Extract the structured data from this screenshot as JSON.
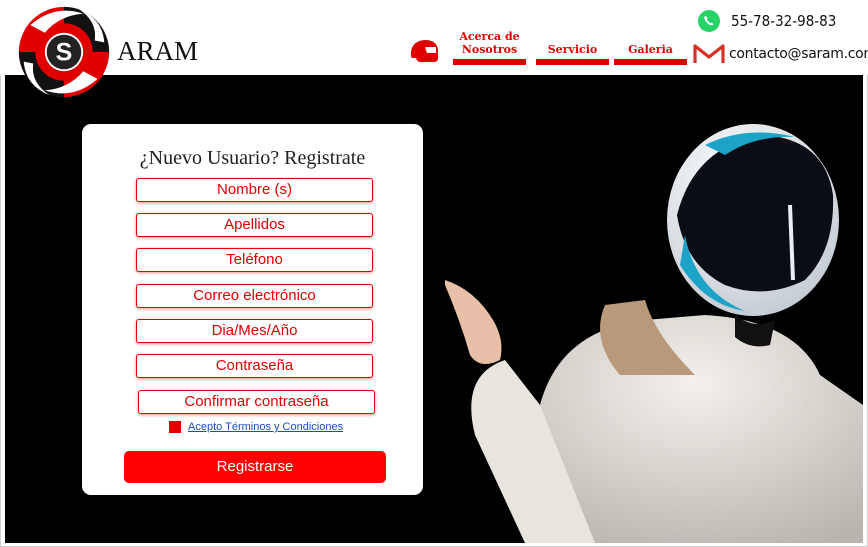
{
  "brand": {
    "name": "ARAM",
    "logo_letter": "S"
  },
  "nav": [
    {
      "label_line1": "Acerca de",
      "label_line2": "Nosotros"
    },
    {
      "label_line1": "Servicio",
      "label_line2": ""
    },
    {
      "label_line1": "Galeria",
      "label_line2": ""
    }
  ],
  "contact": {
    "phone": "55-78-32-98-83",
    "email": "contacto@saram.com"
  },
  "form": {
    "title": "¿Nuevo Usuario? Registrate",
    "fields": [
      "Nombre (s)",
      "Apellidos",
      "Teléfono",
      "Correo electrónico",
      "Dia/Mes/Año",
      "Contraseña",
      "Confirmar contraseña"
    ],
    "terms_label": "Acepto Términos y Condiciones",
    "submit_label": "Registrarse"
  },
  "colors": {
    "accent": "#e00000",
    "hero_bg": "#000000",
    "link": "#1a4fb5",
    "whatsapp": "#25d366"
  }
}
